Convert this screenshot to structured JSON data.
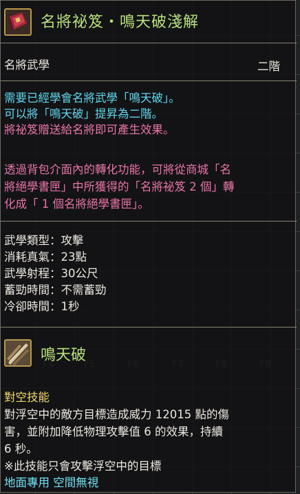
{
  "header": {
    "title": "名將祕笈・鳴天破淺解",
    "icon": "book-icon"
  },
  "meta": {
    "category": "名將武學",
    "grade": "二階"
  },
  "requirement": {
    "line1": "需要已經學會名將武學「鳴天破」。",
    "line2": "可以將「鳴天破」提昇為二階。"
  },
  "effect_note": "將祕笈贈送給名將即可產生效果。",
  "conversion_note": {
    "line1": "透過背包介面內的轉化功能，可將從商城「名",
    "line2": "將絕學書匣」中所獲得的「名將祕笈 2 個」轉",
    "line3": "化成「 1 個名將絕學書匣」。"
  },
  "stats": [
    {
      "label": "武學類型：",
      "value": "攻擊"
    },
    {
      "label": "消耗真氣：",
      "value": "23點"
    },
    {
      "label": "武學射程：",
      "value": "30公尺"
    },
    {
      "label": "蓄勁時間：",
      "value": "不需蓄勁"
    },
    {
      "label": "冷卻時間：",
      "value": "1秒"
    }
  ],
  "skill": {
    "name": "鳴天破",
    "icon": "sword-skill-icon",
    "type": "對空技能",
    "desc_line1": "對浮空中的敵方目標造成威力 12015 點的傷",
    "desc_line2": "害，並附加降低物理攻擊值  6 的效果，持續",
    "desc_line3": "6 秒。",
    "note": "※此技能只會攻擊浮空中的目標",
    "tags": "地面專用 空間無視"
  },
  "background": {
    "fkeys": [
      "F4",
      "F5",
      "F6",
      "F7",
      "F8",
      "F9"
    ]
  },
  "colors": {
    "title": "#b9e07c",
    "requirement": "#60d7ee",
    "effect": "#e874a8",
    "skill_type": "#f2d86b",
    "tags": "#6fe0f0"
  }
}
